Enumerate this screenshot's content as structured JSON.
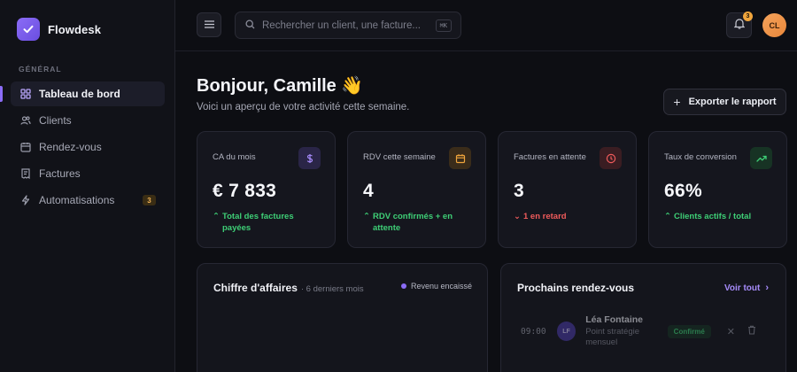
{
  "app": {
    "name": "Flowdesk"
  },
  "sidebar": {
    "section_label": "GÉNÉRAL",
    "items": [
      {
        "label": "Tableau de bord",
        "icon": "dashboard-icon",
        "active": true
      },
      {
        "label": "Clients",
        "icon": "users-icon"
      },
      {
        "label": "Rendez-vous",
        "icon": "calendar-icon"
      },
      {
        "label": "Factures",
        "icon": "invoice-icon"
      },
      {
        "label": "Automatisations",
        "icon": "lightning-icon",
        "badge": "3"
      }
    ]
  },
  "topbar": {
    "search_placeholder": "Rechercher un client, une facture...",
    "search_shortcut": "⌘K",
    "notifications_count": "3",
    "user_initials": "CL"
  },
  "main": {
    "greeting": "Bonjour, Camille 👋",
    "subtitle": "Voici un aperçu de votre activité cette semaine.",
    "export_label": "Exporter le rapport"
  },
  "cards": [
    {
      "label": "CA du mois",
      "value": "€  7 833",
      "trend": "Total des factures payées",
      "trend_dir": "up",
      "icon": "dollar-icon",
      "icon_color": "#a68bfa",
      "icon_bg": "#2a2547"
    },
    {
      "label": "RDV cette semaine",
      "value": "4",
      "trend": "RDV confirmés + en attente",
      "trend_dir": "up",
      "icon": "calendar-icon",
      "icon_color": "#f0a53c",
      "icon_bg": "#3a2c1a"
    },
    {
      "label": "Factures en attente",
      "value": "3",
      "trend": "1 en retard",
      "trend_dir": "down",
      "icon": "clock-icon",
      "icon_color": "#f05b5b",
      "icon_bg": "#3a1d22"
    },
    {
      "label": "Taux de conversion",
      "value": "66%",
      "trend": "Clients actifs / total",
      "trend_dir": "up",
      "icon": "trend-up-icon",
      "icon_color": "#3ecf76",
      "icon_bg": "#173324"
    }
  ],
  "revenue_panel": {
    "title": "Chiffre d'affaires",
    "subtitle": "· 6 derniers mois",
    "legend": "Revenu encaissé"
  },
  "appointments_panel": {
    "title": "Prochains rendez-vous",
    "see_all": "Voir tout",
    "items": [
      {
        "time": "09:00",
        "initials": "LF",
        "name": "Léa Fontaine",
        "desc": "Point stratégie mensuel",
        "status": "Confirmé"
      }
    ]
  },
  "colors": {
    "accent": "#8b6cf6",
    "success": "#3ecf76",
    "danger": "#f05b5b",
    "warning": "#f0a53c"
  }
}
